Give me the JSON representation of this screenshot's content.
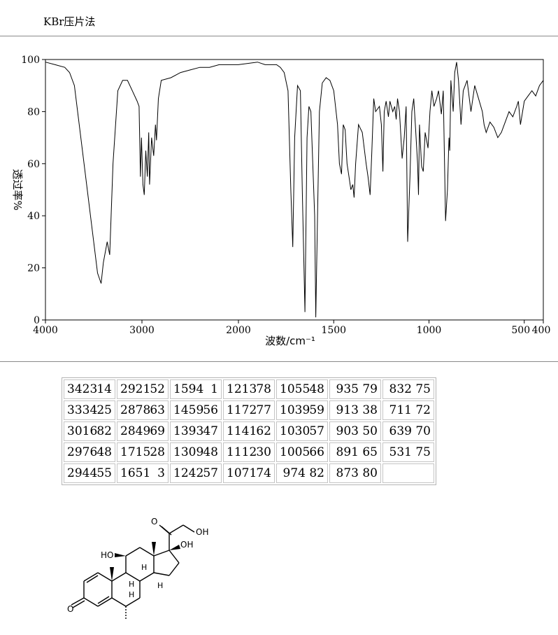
{
  "method_label": "KBr压片法",
  "chart_data": {
    "type": "line",
    "title": "",
    "xlabel": "波数/cm⁻¹",
    "ylabel": "透过率%",
    "xlim": [
      4000,
      400
    ],
    "ylim": [
      0,
      100
    ],
    "x_ticks": [
      "4000",
      "3000",
      "2000",
      "1500",
      "1000",
      "500",
      "400"
    ],
    "y_ticks": [
      "0",
      "20",
      "40",
      "60",
      "80",
      "100"
    ],
    "grid": false,
    "x_scale": "piecewise: 4000-2000 and 2000-400 at different scales",
    "series": [
      {
        "name": "",
        "x": [
          4000,
          3900,
          3800,
          3750,
          3700,
          3600,
          3500,
          3460,
          3423,
          3400,
          3360,
          3334,
          3300,
          3250,
          3200,
          3150,
          3100,
          3050,
          3030,
          3016,
          3005,
          2990,
          2976,
          2960,
          2944,
          2930,
          2921,
          2900,
          2878,
          2860,
          2849,
          2830,
          2800,
          2700,
          2600,
          2500,
          2400,
          2300,
          2200,
          2100,
          2000,
          1900,
          1860,
          1800,
          1780,
          1760,
          1740,
          1725,
          1715,
          1705,
          1690,
          1675,
          1665,
          1651,
          1640,
          1630,
          1620,
          1600,
          1594,
          1585,
          1575,
          1560,
          1540,
          1520,
          1500,
          1480,
          1470,
          1459,
          1450,
          1440,
          1430,
          1420,
          1410,
          1400,
          1393,
          1385,
          1370,
          1350,
          1330,
          1320,
          1309,
          1300,
          1290,
          1280,
          1260,
          1250,
          1242,
          1235,
          1225,
          1213,
          1205,
          1190,
          1180,
          1172,
          1165,
          1155,
          1141,
          1130,
          1120,
          1112,
          1100,
          1090,
          1080,
          1071,
          1060,
          1055,
          1050,
          1039,
          1030,
          1020,
          1005,
          995,
          985,
          974,
          960,
          950,
          935,
          925,
          913,
          903,
          895,
          891,
          885,
          873,
          865,
          855,
          845,
          832,
          820,
          800,
          780,
          760,
          740,
          720,
          711,
          700,
          680,
          660,
          639,
          620,
          600,
          580,
          560,
          540,
          531,
          520,
          500,
          480,
          460,
          440,
          420,
          400
        ],
        "y": [
          99,
          98,
          97,
          95,
          90,
          60,
          30,
          18,
          14,
          22,
          30,
          25,
          60,
          88,
          92,
          92,
          88,
          84,
          82,
          55,
          70,
          52,
          48,
          65,
          55,
          72,
          52,
          70,
          63,
          75,
          69,
          85,
          92,
          93,
          95,
          96,
          97,
          97,
          98,
          98,
          98,
          99,
          98,
          98,
          97,
          95,
          88,
          50,
          28,
          70,
          90,
          88,
          50,
          3,
          70,
          82,
          80,
          40,
          1,
          40,
          80,
          91,
          93,
          92,
          88,
          75,
          60,
          56,
          75,
          73,
          60,
          55,
          50,
          52,
          47,
          60,
          75,
          72,
          60,
          55,
          48,
          65,
          85,
          80,
          82,
          75,
          57,
          80,
          84,
          78,
          84,
          80,
          82,
          77,
          85,
          80,
          62,
          70,
          82,
          30,
          55,
          80,
          85,
          74,
          60,
          48,
          75,
          59,
          57,
          72,
          66,
          80,
          88,
          82,
          85,
          88,
          79,
          88,
          38,
          50,
          70,
          65,
          92,
          80,
          95,
          99,
          92,
          75,
          88,
          92,
          80,
          90,
          85,
          80,
          75,
          72,
          76,
          74,
          70,
          72,
          76,
          80,
          78,
          82,
          84,
          75,
          84,
          86,
          88,
          86,
          90,
          92
        ]
      }
    ]
  },
  "peak_table": {
    "columns": [
      [
        [
          "3423",
          "14"
        ],
        [
          "3334",
          "25"
        ],
        [
          "3016",
          "82"
        ],
        [
          "2976",
          "48"
        ],
        [
          "2944",
          "55"
        ]
      ],
      [
        [
          "2921",
          "52"
        ],
        [
          "2878",
          "63"
        ],
        [
          "2849",
          "69"
        ],
        [
          "1715",
          "28"
        ],
        [
          "1651",
          "3"
        ]
      ],
      [
        [
          "1594",
          "1"
        ],
        [
          "1459",
          "56"
        ],
        [
          "1393",
          "47"
        ],
        [
          "1309",
          "48"
        ],
        [
          "1242",
          "57"
        ]
      ],
      [
        [
          "1213",
          "78"
        ],
        [
          "1172",
          "77"
        ],
        [
          "1141",
          "62"
        ],
        [
          "1112",
          "30"
        ],
        [
          "1071",
          "74"
        ]
      ],
      [
        [
          "1055",
          "48"
        ],
        [
          "1039",
          "59"
        ],
        [
          "1030",
          "57"
        ],
        [
          "1005",
          "66"
        ],
        [
          "974",
          "82"
        ]
      ],
      [
        [
          "935",
          "79"
        ],
        [
          "913",
          "38"
        ],
        [
          "903",
          "50"
        ],
        [
          "891",
          "65"
        ],
        [
          "873",
          "80"
        ]
      ],
      [
        [
          "832",
          "75"
        ],
        [
          "711",
          "72"
        ],
        [
          "639",
          "70"
        ],
        [
          "531",
          "75"
        ],
        [
          "",
          ""
        ]
      ]
    ]
  },
  "structure_labels": {
    "ketone_o": "O",
    "side_chain_o": "O",
    "side_chain_oh": "OH",
    "c11_oh": "HO",
    "c17_oh": "OH",
    "h8": "H",
    "h9": "H",
    "h14": "H",
    "h6": "H"
  }
}
